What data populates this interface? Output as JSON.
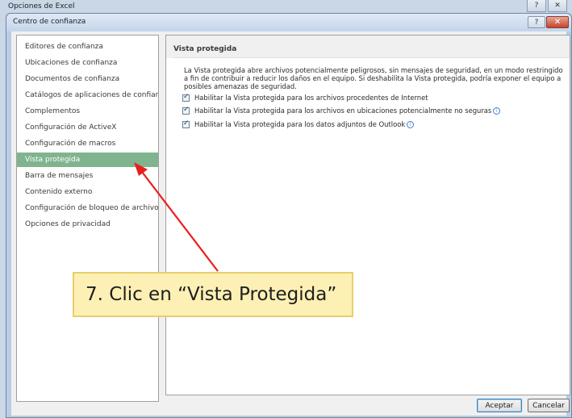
{
  "background_window": {
    "title": "Opciones de Excel",
    "help_label": "?",
    "close_label": "✕"
  },
  "dialog": {
    "title": "Centro de confianza",
    "help_label": "?",
    "close_label": "✕"
  },
  "sidebar": {
    "items": [
      {
        "label": "Editores de confianza"
      },
      {
        "label": "Ubicaciones de confianza"
      },
      {
        "label": "Documentos de confianza"
      },
      {
        "label": "Catálogos de aplicaciones de confianza"
      },
      {
        "label": "Complementos"
      },
      {
        "label": "Configuración de ActiveX"
      },
      {
        "label": "Configuración de macros"
      },
      {
        "label": "Vista protegida",
        "active": true
      },
      {
        "label": "Barra de mensajes"
      },
      {
        "label": "Contenido externo"
      },
      {
        "label": "Configuración de bloqueo de archivos"
      },
      {
        "label": "Opciones de privacidad"
      }
    ]
  },
  "content": {
    "section_title": "Vista protegida",
    "description": "La Vista protegida abre archivos potencialmente peligrosos, sin mensajes de seguridad, en un modo restringido a fin de contribuir a reducir los daños en el equipo. Si deshabilita la Vista protegida, podría exponer el equipo a posibles amenazas de seguridad.",
    "options": [
      {
        "label": "Habilitar la Vista protegida para los archivos procedentes de Internet",
        "checked": true,
        "info": false
      },
      {
        "label": "Habilitar la Vista protegida para los archivos en ubicaciones potencialmente no seguras",
        "checked": true,
        "info": true
      },
      {
        "label": "Habilitar la Vista protegida para los datos adjuntos de Outlook",
        "checked": true,
        "info": true
      }
    ],
    "info_icon_glyph": "i"
  },
  "buttons": {
    "accept": "Aceptar",
    "cancel": "Cancelar"
  },
  "annotation": {
    "text": "7. Clic en “Vista Protegida”",
    "arrow_color": "#e8201c",
    "box_color": "#fdf0b4"
  }
}
